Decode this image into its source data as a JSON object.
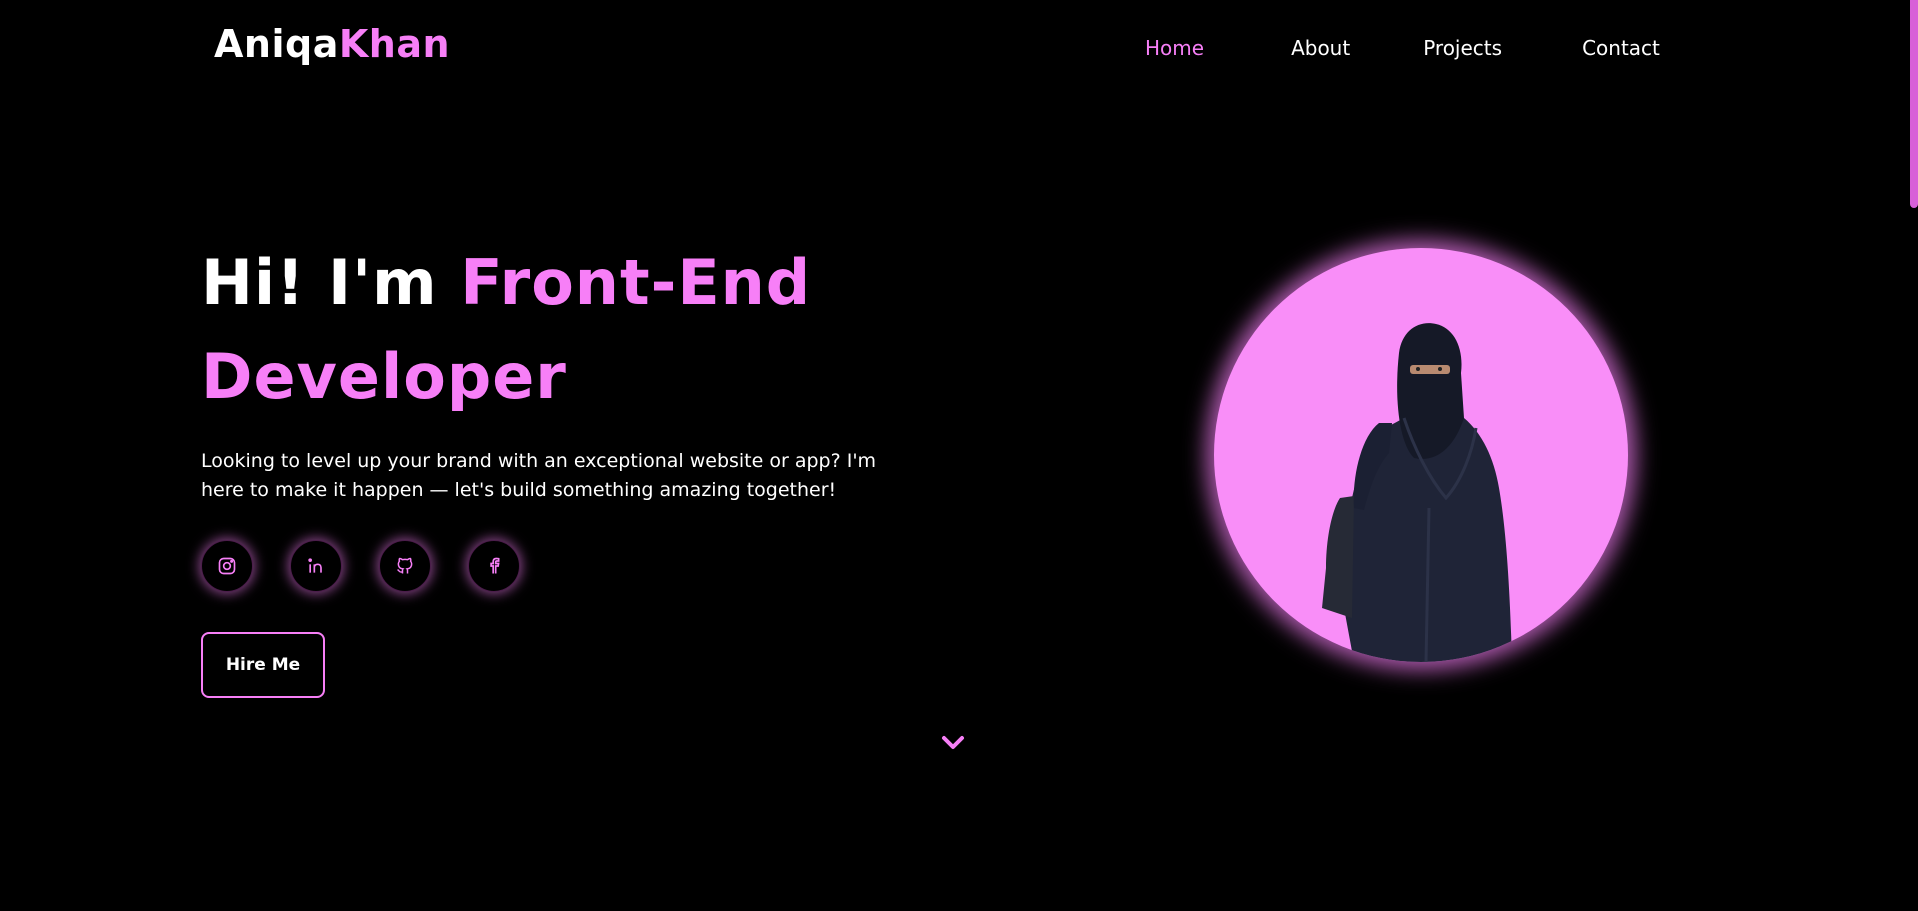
{
  "brand": {
    "first": "Aniqa",
    "last": "Khan"
  },
  "nav": {
    "items": [
      {
        "label": "Home",
        "active": true
      },
      {
        "label": "About",
        "active": false
      },
      {
        "label": "Projects",
        "active": false
      },
      {
        "label": "Contact",
        "active": false
      }
    ]
  },
  "hero": {
    "greeting": "Hi! I'm",
    "role_line1": "Front-End",
    "role_line2": "Developer",
    "tagline": "Looking to level up your brand with an exceptional website or app? I'm here to make it happen — let's build something amazing together!",
    "cta_label": "Hire Me",
    "socials": [
      {
        "icon": "instagram-icon"
      },
      {
        "icon": "linkedin-icon"
      },
      {
        "icon": "github-icon"
      },
      {
        "icon": "facebook-icon"
      }
    ]
  },
  "theme": {
    "accent": "#f77ff7",
    "background": "#000000",
    "portrait_bg": "#f98ef8"
  }
}
